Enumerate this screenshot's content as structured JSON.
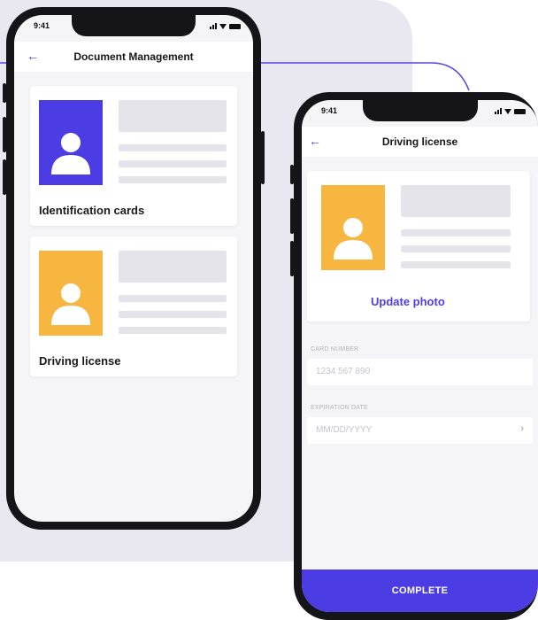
{
  "colors": {
    "accent": "#4e3de6",
    "purple_card": "#4b3ce4",
    "orange_card": "#f6b640",
    "background_panel": "#e9e8f0"
  },
  "phone_left": {
    "status_time": "9:41",
    "back_icon": "arrow-left-icon",
    "title": "Document Management",
    "cards": [
      {
        "label": "Identification cards",
        "color": "#4b3ce4",
        "icon": "person-icon"
      },
      {
        "label": "Driving license",
        "color": "#f6b640",
        "icon": "person-icon"
      }
    ]
  },
  "phone_right": {
    "status_time": "9:41",
    "back_icon": "arrow-left-icon",
    "title": "Driving license",
    "photo_color": "#f6b640",
    "update_photo_label": "Update photo",
    "fields": [
      {
        "label": "CARD NUMBER",
        "value": "1234 567 890"
      },
      {
        "label": "EXPIRATION DATE",
        "placeholder": "MM/DD/YYYY"
      }
    ],
    "complete_label": "COMPLETE"
  }
}
